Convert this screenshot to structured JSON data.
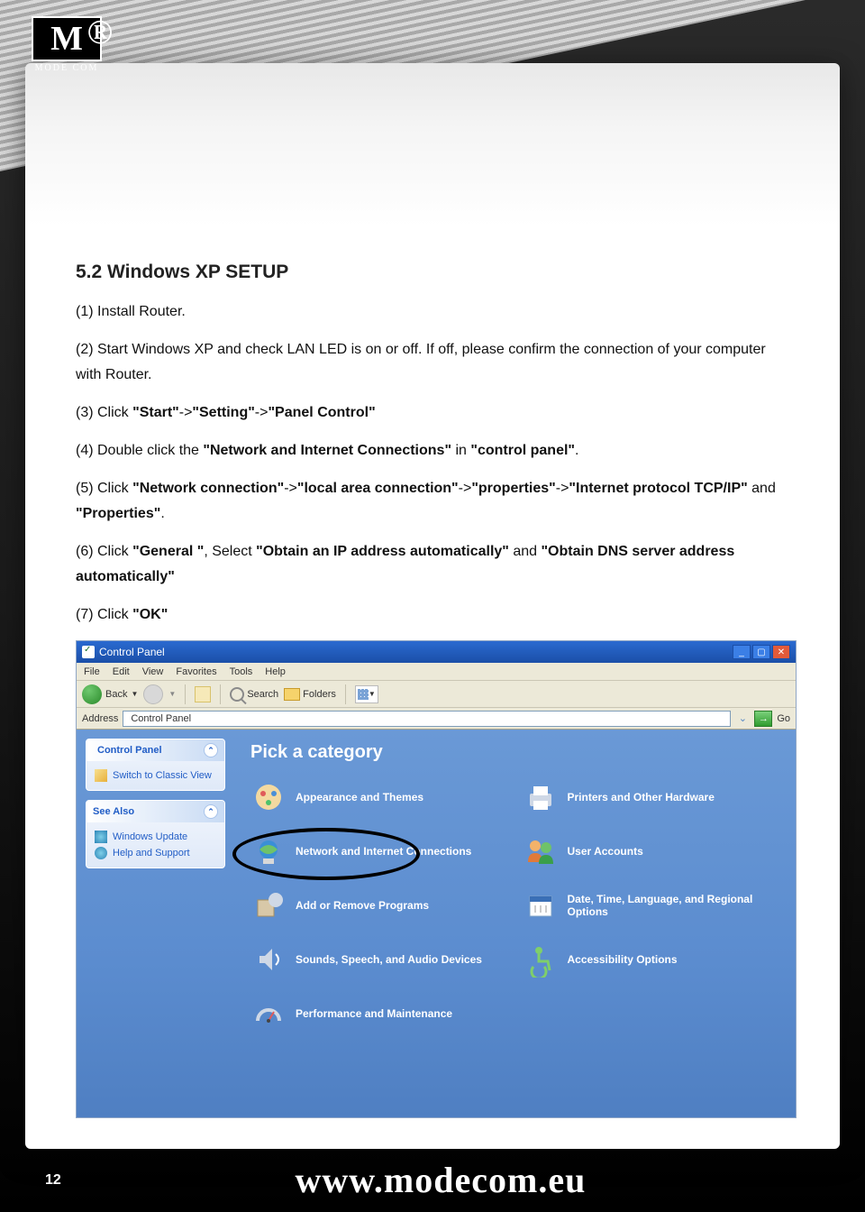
{
  "heading": "5.2 Windows XP SETUP",
  "steps": {
    "s1": "(1) Install Router.",
    "s2a": "(2) Start Windows XP and check LAN LED is on or off. If off, please confirm the connection of your computer with Router.",
    "s3a": "(3) Click ",
    "s3b": "\"Start\"",
    "s3c": "->",
    "s3d": "\"Setting\"",
    "s3e": "->",
    "s3f": "\"Panel Control\"",
    "s4a": "(4) Double click the ",
    "s4b": "\"Network and Internet Connections\"",
    "s4c": " in ",
    "s4d": "\"control panel\"",
    "s4e": ".",
    "s5a": "(5) Click ",
    "s5b": "\"Network connection\"",
    "s5c": "->",
    "s5d": "\"local area connection\"",
    "s5e": "->",
    "s5f": "\"properties\"",
    "s5g": "->",
    "s5h": "\"Internet protocol TCP/IP\"",
    "s5i": " and ",
    "s5j": "\"Properties\"",
    "s5k": ".",
    "s6a": "(6) Click ",
    "s6b": "\"General \"",
    "s6c": ", Select ",
    "s6d": "\"Obtain an IP address automatically\"",
    "s6e": " and ",
    "s6f": "\"Obtain DNS server address automatically\"",
    "s7a": "(7) Click ",
    "s7b": "\"OK\""
  },
  "cp": {
    "title": "Control Panel",
    "menu": {
      "file": "File",
      "edit": "Edit",
      "view": "View",
      "fav": "Favorites",
      "tools": "Tools",
      "help": "Help"
    },
    "tb": {
      "back": "Back",
      "search": "Search",
      "folders": "Folders"
    },
    "addrLabel": "Address",
    "addrValue": "Control Panel",
    "go": "Go",
    "side": {
      "panel1": "Control Panel",
      "switch": "Switch to Classic View",
      "panel2": "See Also",
      "wu": "Windows Update",
      "help": "Help and Support"
    },
    "main": {
      "heading": "Pick a category",
      "cats": {
        "app": "Appearance and Themes",
        "prn": "Printers and Other Hardware",
        "net": "Network and Internet Connections",
        "usr": "User Accounts",
        "add": "Add or Remove Programs",
        "date": "Date, Time, Language, and Regional Options",
        "snd": "Sounds, Speech, and Audio Devices",
        "acc": "Accessibility Options",
        "perf": "Performance and Maintenance"
      }
    }
  },
  "logo": "MODE COM",
  "url": "www.modecom.eu",
  "page": "12"
}
